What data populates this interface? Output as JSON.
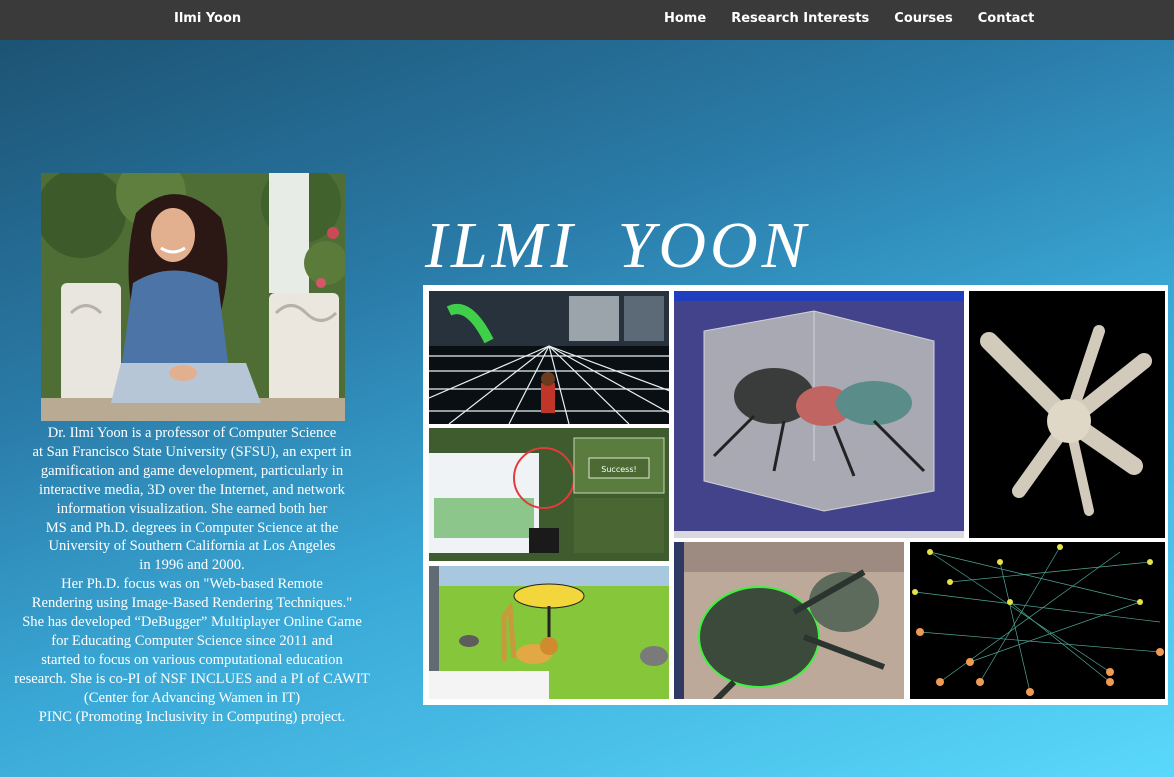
{
  "navbar": {
    "brand": "Ilmi Yoon",
    "links": [
      "Home",
      "Research Interests",
      "Courses",
      "Contact"
    ]
  },
  "hero": {
    "title": "ILMI  YOON"
  },
  "bio": {
    "text": "Dr. Ilmi Yoon is a professor of Computer Science\nat San Francisco State University (SFSU), an expert in\ngamification and game development, particularly in\ninteractive media, 3D over the Internet, and network\ninformation visualization.  She earned both her\nMS and Ph.D. degrees in Computer Science at the\nUniversity of Southern California at Los Angeles\nin 1996 and 2000.\nHer Ph.D. focus was on \"Web-based Remote\nRendering using Image-Based Rendering Techniques.\"\nShe has developed “DeBugger” Multiplayer Online Game\nfor Educating Computer Science since 2011 and\nstarted to focus on various computational education\nresearch. She is co-PI of NSF INCLUES and a PI of CAWIT\n(Center for Advancing Wamen in IT)\nPINC (Promoting Inclusivity in Computing) project."
  },
  "montage": {
    "success_label": "Success!"
  },
  "colors": {
    "navbar": "#3a3a3a",
    "bg_top": "#5ad8fb",
    "bg_bottom": "#1b4f6e"
  }
}
